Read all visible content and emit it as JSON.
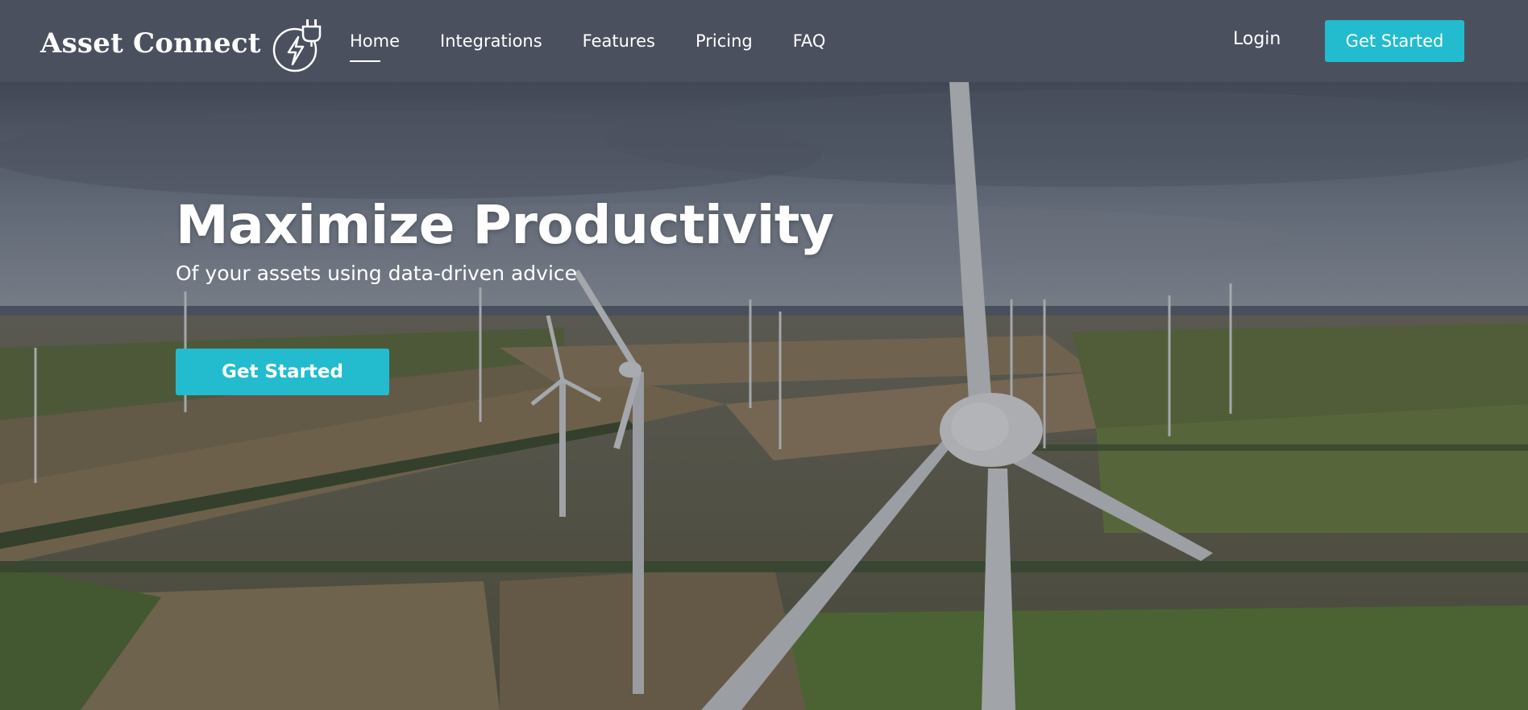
{
  "brand": {
    "name": "Asset Connect",
    "icon": "bolt-plug-icon"
  },
  "nav": {
    "items": [
      {
        "label": "Home",
        "active": true
      },
      {
        "label": "Integrations",
        "active": false
      },
      {
        "label": "Features",
        "active": false
      },
      {
        "label": "Pricing",
        "active": false
      },
      {
        "label": "FAQ",
        "active": false
      }
    ],
    "login_label": "Login",
    "cta_label": "Get Started"
  },
  "hero": {
    "title": "Maximize Productivity",
    "subtitle": "Of your assets using data-driven advice",
    "cta_label": "Get Started"
  },
  "colors": {
    "navbar": "#4b505f",
    "accent": "#22bcce",
    "text": "#ffffff"
  }
}
